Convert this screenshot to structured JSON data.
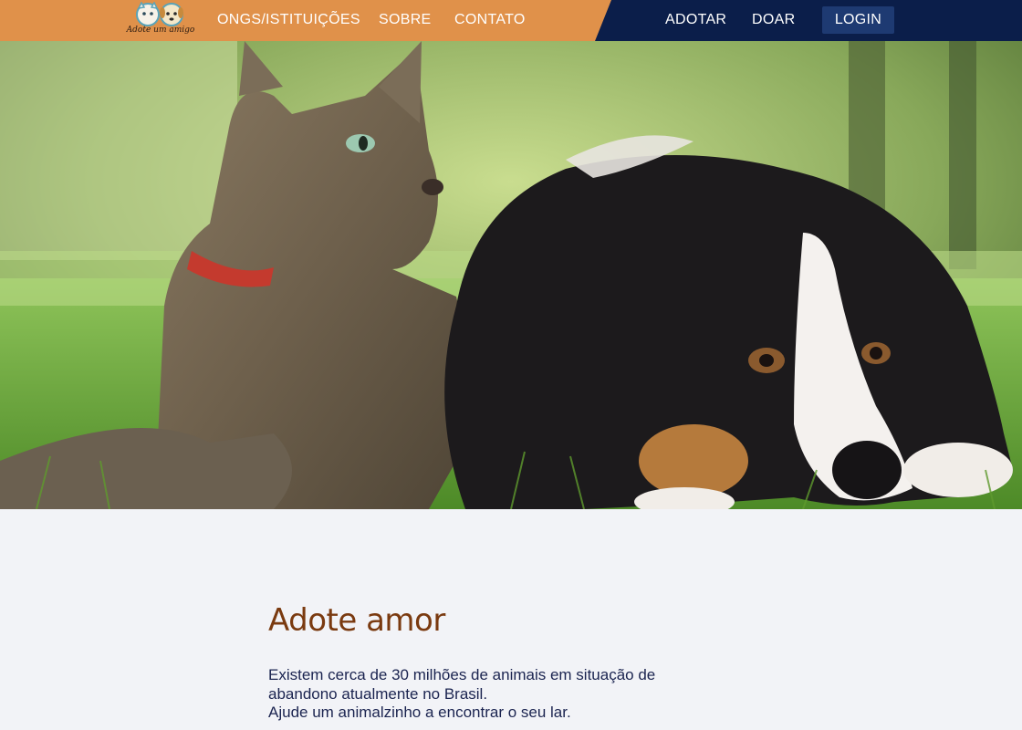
{
  "nav": {
    "logo_text": "Adote um amigo",
    "links_left": [
      "ONGS/ISTITUIÇÕES",
      "SOBRE",
      "CONTATO"
    ],
    "links_right": [
      "ADOTAR",
      "DOAR"
    ],
    "login_label": "LOGIN"
  },
  "colors": {
    "nav_orange": "#e0914a",
    "nav_navy": "#0b1e4a",
    "login_bg": "#1e3a72",
    "headline": "#7a3a10",
    "body_text": "#1b2450",
    "page_bg": "#f2f3f7"
  },
  "main": {
    "headline": "Adote amor",
    "paragraph": [
      "Existem cerca de 30 milhões de animais em situação de",
      "abandono atualmente no Brasil.",
      "Ajude um animalzinho a encontrar o seu lar."
    ]
  }
}
